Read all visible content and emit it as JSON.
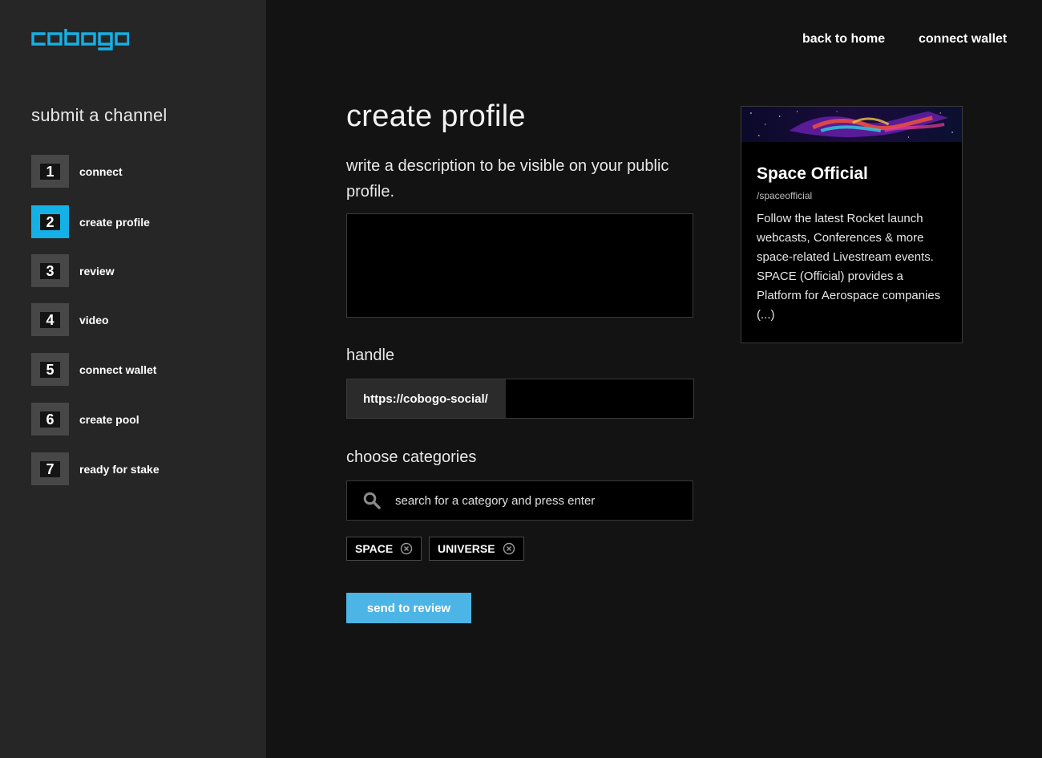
{
  "brand": {
    "logo_text": "cobogo",
    "accent_color": "#14b1e7"
  },
  "sidebar": {
    "title": "submit a channel",
    "steps": [
      {
        "number": "1",
        "label": "connect",
        "active": false
      },
      {
        "number": "2",
        "label": "create profile",
        "active": true
      },
      {
        "number": "3",
        "label": "review",
        "active": false
      },
      {
        "number": "4",
        "label": "video",
        "active": false
      },
      {
        "number": "5",
        "label": "connect wallet",
        "active": false
      },
      {
        "number": "6",
        "label": "create pool",
        "active": false
      },
      {
        "number": "7",
        "label": "ready for stake",
        "active": false
      }
    ]
  },
  "header": {
    "back_home": "back to home",
    "connect_wallet": "connect wallet"
  },
  "main": {
    "title": "create profile",
    "description_label": "write a description to be visible on your public profile.",
    "description_value": "",
    "handle_label": "handle",
    "handle_prefix": "https://cobogo-social/",
    "handle_value": "",
    "categories_label": "choose categories",
    "category_search_placeholder": "search for a category and press enter",
    "tags": [
      {
        "label": "SPACE",
        "remove_icon": "close-circle-icon"
      },
      {
        "label": "UNIVERSE",
        "remove_icon": "close-circle-icon"
      }
    ],
    "submit_label": "send to review",
    "submit_color": "#4cb5e5"
  },
  "preview_card": {
    "title": "Space Official",
    "handle": "/spaceofficial",
    "description": "Follow the latest Rocket launch webcasts, Conferences & more space-related Livestream events. SPACE (Official) provides a Platform for Aerospace companies (...)"
  }
}
